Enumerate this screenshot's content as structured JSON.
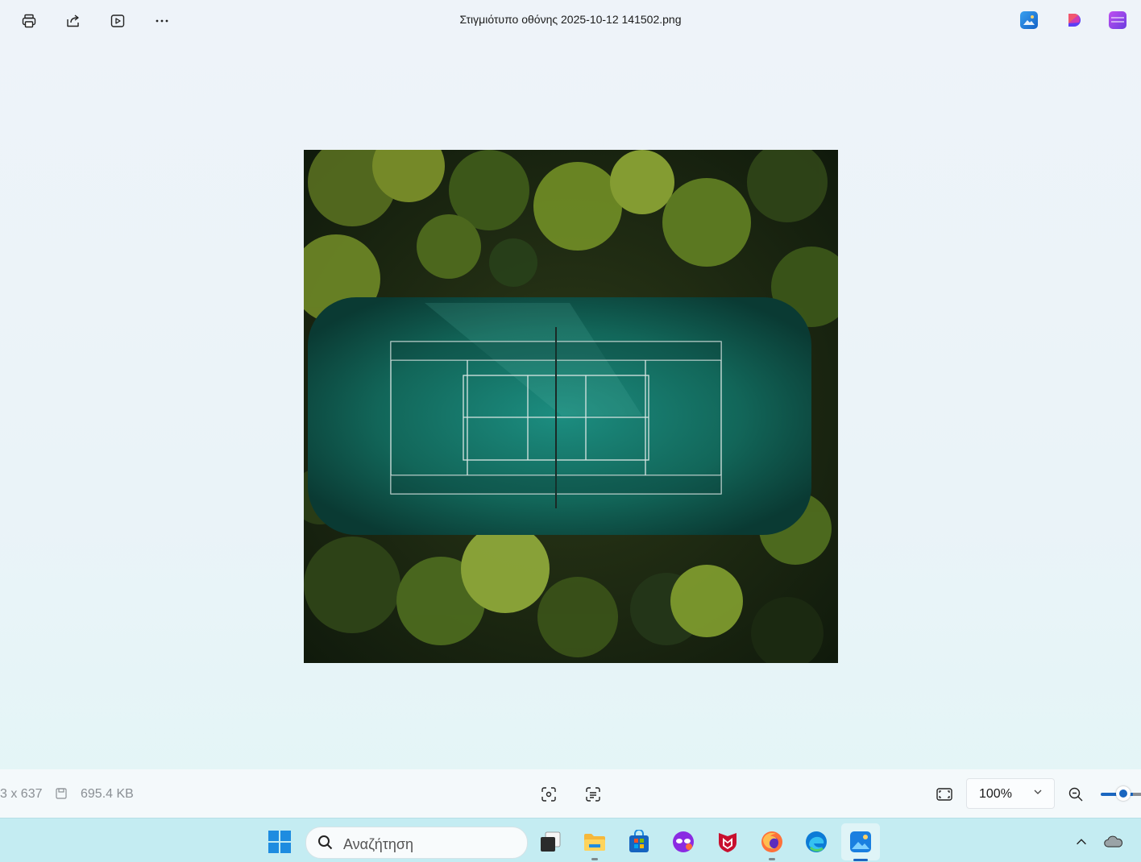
{
  "toolbar": {
    "print": "print-icon",
    "share": "share-icon",
    "slideshow": "slideshow-icon",
    "more": "more-icon",
    "title": "Στιγμιότυπο οθόνης 2025-10-12 141502.png",
    "apps": [
      "photos-app-icon",
      "designer-app-icon",
      "clipchamp-app-icon"
    ]
  },
  "status": {
    "dimensions": "3 x 637",
    "file_size": "695.4 KB",
    "zoom": "100%",
    "zoom_slider_fraction": 0.6
  },
  "taskbar": {
    "search_placeholder": "Αναζήτηση",
    "apps": [
      "start",
      "task-view",
      "file-explorer",
      "store",
      "copilot",
      "mcafee",
      "firefox",
      "edge",
      "photos"
    ]
  }
}
